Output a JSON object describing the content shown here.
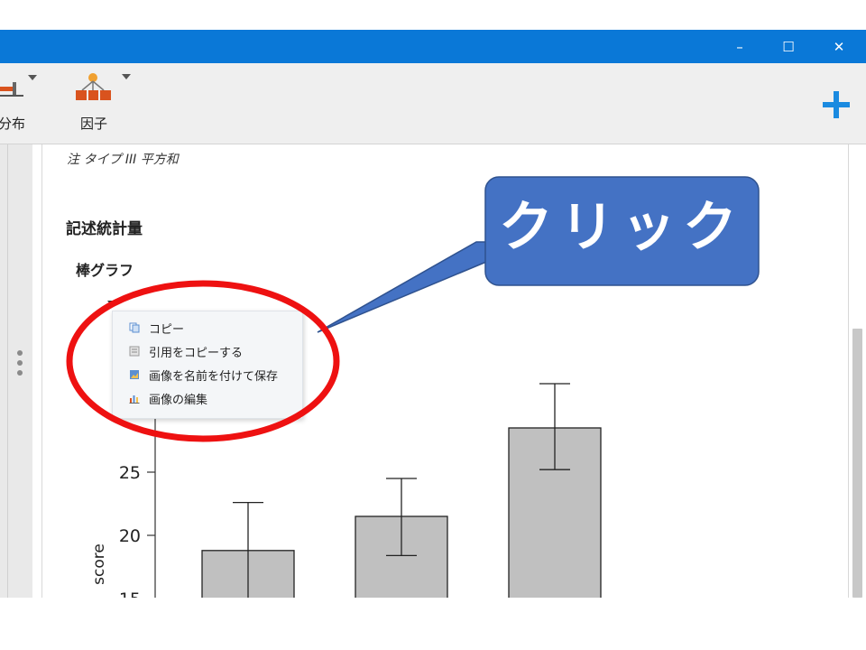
{
  "window": {
    "controls": {
      "minimize": "–",
      "maximize": "☐",
      "close": "✕"
    }
  },
  "toolbar": {
    "items": [
      {
        "label": "分布",
        "icon": "distribution-icon"
      },
      {
        "label": "因子",
        "icon": "factor-icon"
      }
    ],
    "add_button": "+"
  },
  "results": {
    "footnote": "注 タイプ III 平方和",
    "section_title": "記述統計量",
    "subsection_title": "棒グラフ"
  },
  "context_menu": {
    "items": [
      {
        "label": "コピー",
        "icon": "copy-icon"
      },
      {
        "label": "引用をコピーする",
        "icon": "citation-icon"
      },
      {
        "label": "画像を名前を付けて保存",
        "icon": "save-image-icon"
      },
      {
        "label": "画像の編集",
        "icon": "edit-chart-icon"
      }
    ]
  },
  "annotation": {
    "callout_text": "クリック",
    "callout_color": "#4472c4",
    "ellipse_color": "#ee1111"
  },
  "chart_data": {
    "type": "bar",
    "categories": [
      "",
      "",
      ""
    ],
    "values": [
      18.8,
      21.5,
      28.5
    ],
    "error_low": [
      15.0,
      18.4,
      25.2
    ],
    "error_high": [
      22.6,
      24.5,
      32.0
    ],
    "ylabel": "score",
    "yticks": [
      15,
      20,
      25
    ],
    "bar_color": "#c0c0c0"
  }
}
